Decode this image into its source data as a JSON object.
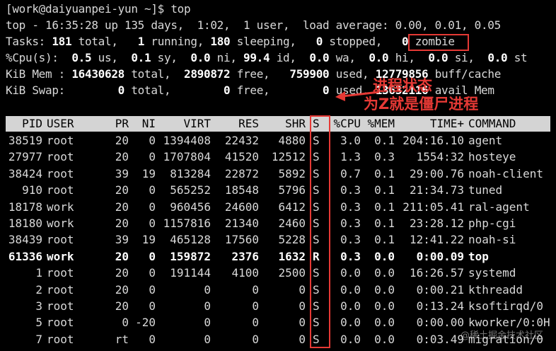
{
  "prompt": "[work@daiyuanpei-yun ~]$ top",
  "summary": {
    "top_line": "top - 16:35:28 up 135 days,  1:02,  1 user,  load average: 0.00, 0.01, 0.05",
    "tasks_prefix": "Tasks: ",
    "tasks_total": "181",
    "tasks_total_lbl": " total,   ",
    "tasks_running": "1",
    "tasks_running_lbl": " running, ",
    "tasks_sleeping": "180",
    "tasks_sleeping_lbl": " sleeping,   ",
    "tasks_stopped": "0",
    "tasks_stopped_lbl": " stopped,   ",
    "tasks_zombie": "0",
    "tasks_zombie_lbl": " zombie",
    "cpu_prefix": "%Cpu(s):  ",
    "cpu_us": "0.5",
    "cpu_us_lbl": " us,  ",
    "cpu_sy": "0.1",
    "cpu_sy_lbl": " sy,  ",
    "cpu_ni": "0.0",
    "cpu_ni_lbl": " ni, ",
    "cpu_id": "99.4",
    "cpu_id_lbl": " id,  ",
    "cpu_wa": "0.0",
    "cpu_wa_lbl": " wa,  ",
    "cpu_hi": "0.0",
    "cpu_hi_lbl": " hi,  ",
    "cpu_si": "0.0",
    "cpu_si_lbl": " si,  ",
    "cpu_st": "0.0",
    "cpu_st_lbl": " st",
    "mem_prefix": "KiB Mem : ",
    "mem_total": "16430628",
    "mem_total_lbl": " total,  ",
    "mem_free": "2890872",
    "mem_free_lbl": " free,   ",
    "mem_used": "759900",
    "mem_used_lbl": " used, ",
    "mem_buff": "12779856",
    "mem_buff_lbl": " buff/cache",
    "swap_prefix": "KiB Swap:        ",
    "swap_total": "0",
    "swap_total_lbl": " total,        ",
    "swap_free": "0",
    "swap_free_lbl": " free,        ",
    "swap_used": "0",
    "swap_used_lbl": " used. ",
    "swap_avail": "13632116",
    "swap_avail_lbl": " avail Mem"
  },
  "columns": [
    "PID",
    "USER",
    "PR",
    "NI",
    "VIRT",
    "RES",
    "SHR",
    "S",
    "%CPU",
    "%MEM",
    "TIME+",
    "COMMAND"
  ],
  "processes": [
    [
      "38519",
      "root",
      "20",
      "0",
      "1394408",
      "22432",
      "4880",
      "S",
      "3.0",
      "0.1",
      "204:16.10",
      "agent"
    ],
    [
      "27977",
      "root",
      "20",
      "0",
      "1707804",
      "41520",
      "12512",
      "S",
      "1.3",
      "0.3",
      "1554:32",
      "hosteye"
    ],
    [
      "38424",
      "root",
      "39",
      "19",
      "813284",
      "22872",
      "5892",
      "S",
      "0.7",
      "0.1",
      "29:00.76",
      "noah-client"
    ],
    [
      "910",
      "root",
      "20",
      "0",
      "565252",
      "18548",
      "5796",
      "S",
      "0.3",
      "0.1",
      "21:34.73",
      "tuned"
    ],
    [
      "18178",
      "work",
      "20",
      "0",
      "960456",
      "24600",
      "6412",
      "S",
      "0.3",
      "0.1",
      "211:05.41",
      "ral-agent"
    ],
    [
      "18180",
      "work",
      "20",
      "0",
      "1157816",
      "21340",
      "2460",
      "S",
      "0.3",
      "0.1",
      "23:28.12",
      "php-cgi"
    ],
    [
      "38439",
      "root",
      "39",
      "19",
      "465128",
      "17560",
      "5228",
      "S",
      "0.3",
      "0.1",
      "12:41.22",
      "noah-si"
    ],
    [
      "61336",
      "work",
      "20",
      "0",
      "159872",
      "2376",
      "1632",
      "R",
      "0.3",
      "0.0",
      "0:00.09",
      "top"
    ],
    [
      "1",
      "root",
      "20",
      "0",
      "191144",
      "4100",
      "2500",
      "S",
      "0.0",
      "0.0",
      "16:26.57",
      "systemd"
    ],
    [
      "2",
      "root",
      "20",
      "0",
      "0",
      "0",
      "0",
      "S",
      "0.0",
      "0.0",
      "0:00.21",
      "kthreadd"
    ],
    [
      "3",
      "root",
      "20",
      "0",
      "0",
      "0",
      "0",
      "S",
      "0.0",
      "0.0",
      "0:13.24",
      "ksoftirqd/0"
    ],
    [
      "5",
      "root",
      "0",
      "-20",
      "0",
      "0",
      "0",
      "S",
      "0.0",
      "0.0",
      "0:00.00",
      "kworker/0:0H"
    ],
    [
      "7",
      "root",
      "rt",
      "0",
      "0",
      "0",
      "0",
      "S",
      "0.0",
      "0.0",
      "0:03.49",
      "migration/0"
    ]
  ],
  "annotation": {
    "line1": "进程状态",
    "line2": "为Z就是僵尸进程"
  },
  "watermark": "@稀土掘金技术社区",
  "colors": {
    "background": "#000000",
    "text": "#d9d9d9",
    "header_bg": "#d4d4d4",
    "highlight_red": "#e53935"
  }
}
